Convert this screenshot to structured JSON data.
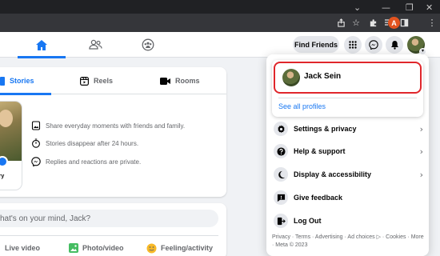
{
  "browser": {
    "window_controls": [
      "⌄",
      "—",
      "❐",
      "✕"
    ],
    "toolbar_icons": [
      "share-icon",
      "star-icon",
      "extensions-icon",
      "reading-list-icon",
      "side-panel-icon"
    ],
    "profile_initial": "A",
    "menu_icon": "more-vert-icon"
  },
  "topbar": {
    "nav_tabs": [
      {
        "name": "home",
        "icon": "home-icon",
        "active": true
      },
      {
        "name": "friends",
        "icon": "friends-icon",
        "active": false
      },
      {
        "name": "groups",
        "icon": "groups-icon",
        "active": false
      }
    ],
    "find_friends_label": "Find Friends",
    "icons": [
      "menu-grid-icon",
      "messenger-icon",
      "notifications-icon"
    ]
  },
  "stories": {
    "tabs": [
      {
        "label": "Stories",
        "icon": "book-icon",
        "active": true
      },
      {
        "label": "Reels",
        "icon": "reels-icon",
        "active": false
      },
      {
        "label": "Rooms",
        "icon": "video-icon",
        "active": false
      }
    ],
    "create_label": "tory",
    "info": [
      {
        "icon": "photo-frame-icon",
        "text": "Share everyday moments with friends and family."
      },
      {
        "icon": "stopwatch-icon",
        "text": "Stories disappear after 24 hours."
      },
      {
        "icon": "messenger-icon",
        "text": "Replies and reactions are private."
      }
    ]
  },
  "composer": {
    "placeholder": "hat's on your mind, Jack?",
    "actions": [
      {
        "label": "Live video",
        "icon": "live-video-icon",
        "color": "#f02849"
      },
      {
        "label": "Photo/video",
        "icon": "photo-icon",
        "color": "#45bd62"
      },
      {
        "label": "Feeling/activity",
        "icon": "smile-icon",
        "color": "#f7b928"
      }
    ]
  },
  "account_menu": {
    "profile_name": "Jack Sein",
    "see_all_profiles": "See all profiles",
    "items": [
      {
        "label": "Settings & privacy",
        "icon": "gear-icon",
        "chevron": true
      },
      {
        "label": "Help & support",
        "icon": "help-icon",
        "chevron": true
      },
      {
        "label": "Display & accessibility",
        "icon": "moon-icon",
        "chevron": true
      },
      {
        "label": "Give feedback",
        "icon": "feedback-icon",
        "chevron": false
      },
      {
        "label": "Log Out",
        "icon": "logout-icon",
        "chevron": false
      }
    ],
    "footer": "Privacy · Terms · Advertising · Ad choices ▷ · Cookies · More · Meta © 2023"
  },
  "colors": {
    "accent": "#1877f2",
    "highlight_border": "#e0262b",
    "page_bg": "#f0f2f5"
  }
}
